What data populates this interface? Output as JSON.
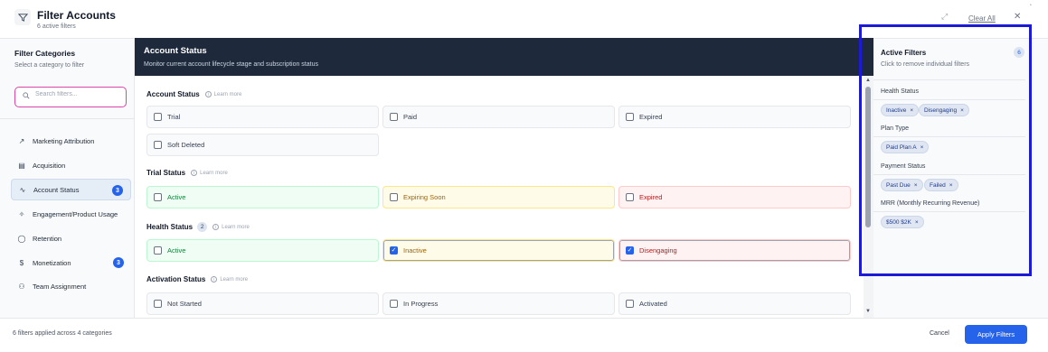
{
  "header": {
    "title": "Filter Accounts",
    "subtitle": "6 active filters",
    "clear_all": "Clear All",
    "close": "✕",
    "expand": "⤢"
  },
  "sidebar": {
    "title": "Filter Categories",
    "subtitle": "Select a category to filter",
    "search_placeholder": "Search filters...",
    "items": [
      {
        "label": "Marketing Attribution",
        "icon": "trend-icon",
        "glyph": "↗",
        "badge": ""
      },
      {
        "label": "Acquisition",
        "icon": "document-icon",
        "glyph": "▤",
        "badge": ""
      },
      {
        "label": "Account Status",
        "icon": "activity-icon",
        "glyph": "∿",
        "badge": "3",
        "active": true
      },
      {
        "label": "Engagement/Product Usage",
        "icon": "puzzle-icon",
        "glyph": "✧",
        "badge": ""
      },
      {
        "label": "Retention",
        "icon": "shield-icon",
        "glyph": "◯",
        "badge": ""
      },
      {
        "label": "Monetization",
        "icon": "dollar-icon",
        "glyph": "$",
        "badge": "3"
      },
      {
        "label": "Team Assignment",
        "icon": "users-icon",
        "glyph": "⚇",
        "badge": ""
      }
    ]
  },
  "main": {
    "title": "Account Status",
    "subtitle": "Monitor current account lifecycle stage and subscription status",
    "learn_more": "Learn more",
    "sections": [
      {
        "title": "Account Status",
        "count": "",
        "options": [
          {
            "label": "Trial",
            "checked": false,
            "tone": "plain"
          },
          {
            "label": "Paid",
            "checked": false,
            "tone": "plain"
          },
          {
            "label": "Expired",
            "checked": false,
            "tone": "plain"
          },
          {
            "label": "Soft Deleted",
            "checked": false,
            "tone": "plain"
          }
        ]
      },
      {
        "title": "Trial Status",
        "count": "",
        "options": [
          {
            "label": "Active",
            "checked": false,
            "tone": "green"
          },
          {
            "label": "Expiring Soon",
            "checked": false,
            "tone": "yellow"
          },
          {
            "label": "Expired",
            "checked": false,
            "tone": "red"
          }
        ]
      },
      {
        "title": "Health Status",
        "count": "2",
        "options": [
          {
            "label": "Active",
            "checked": false,
            "tone": "green"
          },
          {
            "label": "Inactive",
            "checked": true,
            "tone": "yellow"
          },
          {
            "label": "Disengaging",
            "checked": true,
            "tone": "red"
          }
        ]
      },
      {
        "title": "Activation Status",
        "count": "",
        "options": [
          {
            "label": "Not Started",
            "checked": false,
            "tone": "plain"
          },
          {
            "label": "In Progress",
            "checked": false,
            "tone": "plain"
          },
          {
            "label": "Activated",
            "checked": false,
            "tone": "plain"
          }
        ]
      }
    ]
  },
  "active_filters": {
    "title": "Active Filters",
    "subtitle": "Click to remove individual filters",
    "count": "6",
    "groups": [
      {
        "name": "Health Status",
        "chips": [
          "Inactive",
          "Disengaging"
        ]
      },
      {
        "name": "Plan Type",
        "chips": [
          "Paid Plan A"
        ]
      },
      {
        "name": "Payment Status",
        "chips": [
          "Past Due",
          "Failed"
        ]
      },
      {
        "name": "MRR (Monthly Recurring Revenue)",
        "chips": [
          "$500 $2K"
        ]
      }
    ]
  },
  "footer": {
    "summary": "6 filters applied across 4 categories",
    "cancel": "Cancel",
    "apply": "Apply Filters"
  },
  "colors": {
    "accent": "#2563eb",
    "header_dark": "#1e293b",
    "focus_outline": "#1d1ad6"
  }
}
